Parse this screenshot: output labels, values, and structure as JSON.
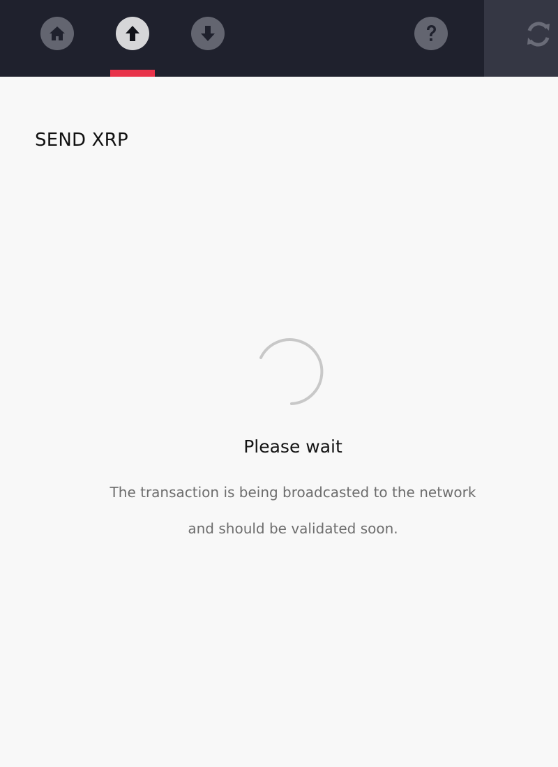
{
  "nav": {
    "items": [
      {
        "id": "home",
        "icon": "home-icon",
        "active": false
      },
      {
        "id": "send",
        "icon": "arrow-up-icon",
        "active": true
      },
      {
        "id": "receive",
        "icon": "arrow-down-icon",
        "active": false
      },
      {
        "id": "help",
        "icon": "question-icon",
        "active": false
      }
    ],
    "refresh_icon": "refresh-icon",
    "accent_color": "#e8334a",
    "bar_color": "#1f212d"
  },
  "page": {
    "title": "SEND XRP"
  },
  "status": {
    "heading": "Please wait",
    "line1": "The transaction is being broadcasted to the network",
    "line2": "and should be validated soon.",
    "spinner_icon": "loading-spinner-icon"
  }
}
